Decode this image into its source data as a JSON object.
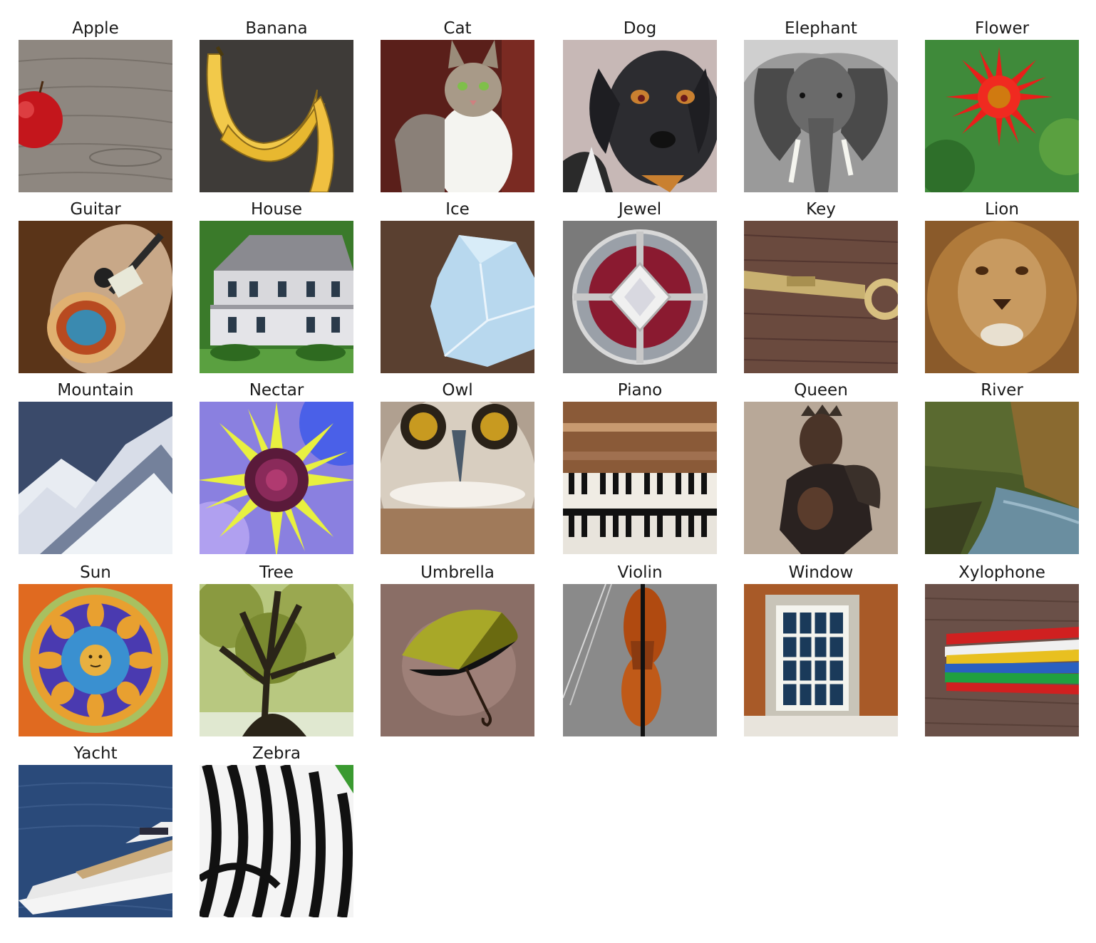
{
  "tiles": [
    {
      "label": "Apple",
      "icon": "apple-icon"
    },
    {
      "label": "Banana",
      "icon": "banana-icon"
    },
    {
      "label": "Cat",
      "icon": "cat-icon"
    },
    {
      "label": "Dog",
      "icon": "dog-icon"
    },
    {
      "label": "Elephant",
      "icon": "elephant-icon"
    },
    {
      "label": "Flower",
      "icon": "flower-icon"
    },
    {
      "label": "Guitar",
      "icon": "guitar-icon"
    },
    {
      "label": "House",
      "icon": "house-icon"
    },
    {
      "label": "Ice",
      "icon": "ice-icon"
    },
    {
      "label": "Jewel",
      "icon": "jewel-icon"
    },
    {
      "label": "Key",
      "icon": "key-icon"
    },
    {
      "label": "Lion",
      "icon": "lion-icon"
    },
    {
      "label": "Mountain",
      "icon": "mountain-icon"
    },
    {
      "label": "Nectar",
      "icon": "nectar-icon"
    },
    {
      "label": "Owl",
      "icon": "owl-icon"
    },
    {
      "label": "Piano",
      "icon": "piano-icon"
    },
    {
      "label": "Queen",
      "icon": "queen-icon"
    },
    {
      "label": "River",
      "icon": "river-icon"
    },
    {
      "label": "Sun",
      "icon": "sun-icon"
    },
    {
      "label": "Tree",
      "icon": "tree-icon"
    },
    {
      "label": "Umbrella",
      "icon": "umbrella-icon"
    },
    {
      "label": "Violin",
      "icon": "violin-icon"
    },
    {
      "label": "Window",
      "icon": "window-icon"
    },
    {
      "label": "Xylophone",
      "icon": "xylophone-icon"
    },
    {
      "label": "Yacht",
      "icon": "yacht-icon"
    },
    {
      "label": "Zebra",
      "icon": "zebra-icon"
    }
  ]
}
